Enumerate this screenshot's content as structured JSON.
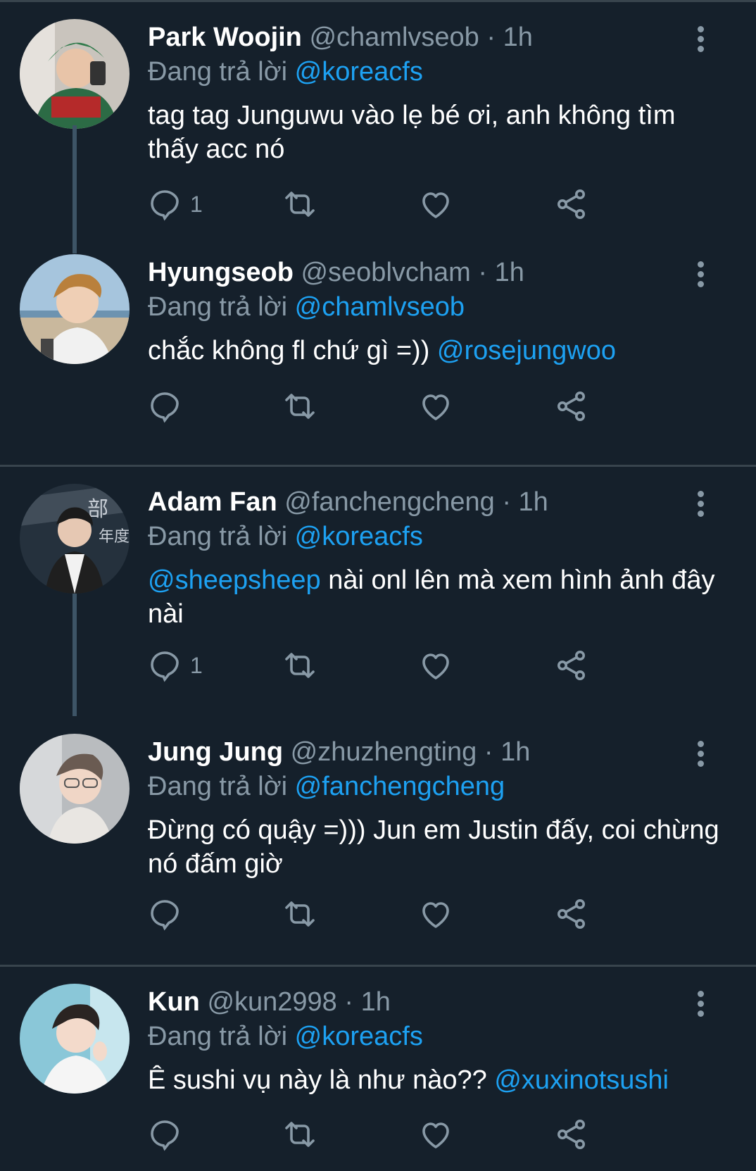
{
  "colors": {
    "background": "#15202b",
    "secondary": "#8899a6",
    "link": "#1da1f2",
    "divider": "#38444d"
  },
  "tweets": [
    {
      "name": "Park Woojin",
      "handle": "@chamlvseob",
      "time": "1h",
      "reply_prefix": "Đang trả lời",
      "reply_to": "@koreacfs",
      "text_before": "tag tag Junguwu vào lẹ bé ơi, anh không tìm thấy acc nó",
      "mention": "",
      "text_after": "",
      "reply_count": "1"
    },
    {
      "name": "Hyungseob",
      "handle": "@seoblvcham",
      "time": "1h",
      "reply_prefix": "Đang trả lời",
      "reply_to": "@chamlvseob",
      "text_before": "chắc không fl chứ gì =)) ",
      "mention": "@rosejungwoo",
      "text_after": "",
      "reply_count": ""
    },
    {
      "name": "Adam Fan",
      "handle": "@fanchengcheng",
      "time": "1h",
      "reply_prefix": "Đang trả lời",
      "reply_to": "@koreacfs",
      "text_before": "",
      "mention": "@sheepsheep",
      "text_after": " nài onl lên mà xem hình ảnh đây nài",
      "reply_count": "1"
    },
    {
      "name": "Jung Jung",
      "handle": "@zhuzhengting",
      "time": "1h",
      "reply_prefix": "Đang trả lời",
      "reply_to": "@fanchengcheng",
      "text_before": "Đừng có quậy =))) Jun em Justin đấy, coi chừng nó đấm giờ",
      "mention": "",
      "text_after": "",
      "reply_count": ""
    },
    {
      "name": "Kun",
      "handle": "@kun2998",
      "time": "1h",
      "reply_prefix": "Đang trả lời",
      "reply_to": "@koreacfs",
      "text_before": "Ê sushi vụ này là như nào?? ",
      "mention": "@xuxinotsushi",
      "text_after": "",
      "reply_count": ""
    }
  ],
  "icons": [
    "reply-icon",
    "retweet-icon",
    "like-icon",
    "share-icon",
    "more-icon"
  ]
}
